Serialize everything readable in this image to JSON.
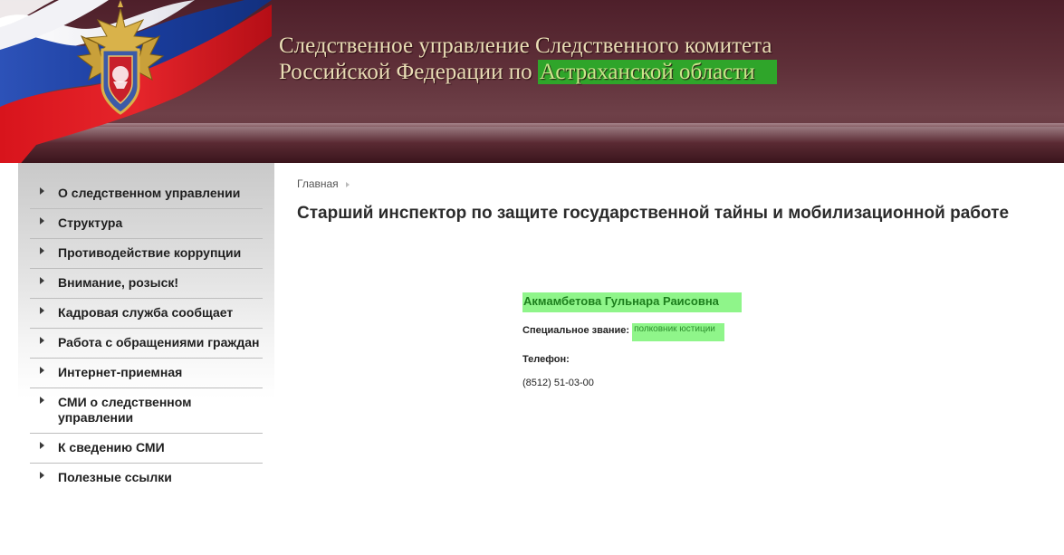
{
  "header": {
    "title_line1": "Следственное управление Следственного комитета",
    "title_line2_prefix": "Российской Федерации по ",
    "title_line2_highlight": "Астраханской области",
    "colors": {
      "background": "#5e2f38",
      "title": "#e9ddb5",
      "highlight": "#2fa52a"
    },
    "emblem_icon": "investigative-committee-emblem-icon",
    "flag_icon": "russian-flag-icon"
  },
  "sidebar": {
    "items": [
      {
        "label": "О следственном управлении"
      },
      {
        "label": "Структура"
      },
      {
        "label": "Противодействие коррупции"
      },
      {
        "label": "Внимание, розыск!"
      },
      {
        "label": "Кадровая служба сообщает"
      },
      {
        "label": "Работа с обращениями граждан"
      },
      {
        "label": "Интернет-приемная"
      },
      {
        "label": "СМИ о следственном управлении"
      },
      {
        "label": "К сведению СМИ"
      },
      {
        "label": "Полезные ссылки"
      }
    ]
  },
  "breadcrumb": {
    "home": "Главная"
  },
  "main": {
    "title": "Старший инспектор по защите государственной тайны и мобилизационной работе",
    "person": {
      "name": "Акмамбетова Гульнара Раисовна",
      "rank_label": "Специальное звание:",
      "rank_value": "полковник юстиции",
      "phone_label": "Телефон:",
      "phone_value": "(8512) 51-03-00"
    }
  }
}
